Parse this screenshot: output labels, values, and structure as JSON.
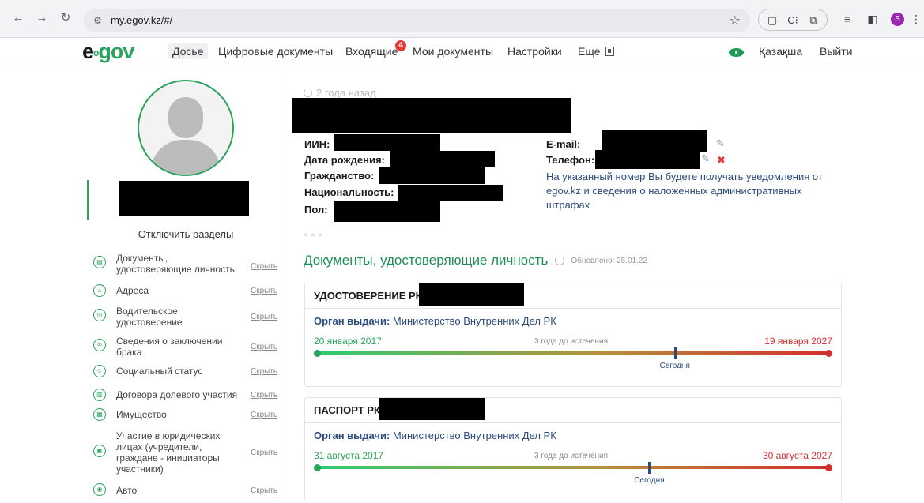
{
  "browser": {
    "url": "my.egov.kz/#/",
    "profile_initial": "S"
  },
  "header": {
    "logo_e": "e",
    "logo_o": "o",
    "logo_gov": "gov",
    "menu": [
      "Досье",
      "Цифровые документы",
      "Входящие",
      "Мои документы",
      "Настройки",
      "Еще"
    ],
    "inbox_count": "4",
    "language": "Қазақша",
    "logout": "Выйти"
  },
  "sidebar": {
    "toggle_sections": "Отключить разделы",
    "hide_label": "Скрыть",
    "items": [
      {
        "label": "Документы, удостоверяющие личность",
        "icon": "id-card-icon"
      },
      {
        "label": "Адреса",
        "icon": "home-icon"
      },
      {
        "label": "Водительское удостоверение",
        "icon": "steering-wheel-icon"
      },
      {
        "label": "Сведения о заключении брака",
        "icon": "rings-icon"
      },
      {
        "label": "Социальный статус",
        "icon": "people-icon"
      },
      {
        "label": "Договора долевого участия",
        "icon": "contract-icon"
      },
      {
        "label": "Имущество",
        "icon": "property-icon"
      },
      {
        "label": "Участие в юридических лицах (учредители, граждане - инициаторы, участники)",
        "icon": "legal-entity-icon"
      },
      {
        "label": "Авто",
        "icon": "car-icon"
      }
    ]
  },
  "profile": {
    "updated_ago": "2 года назад",
    "fields_left": [
      "ИИН:",
      "Дата рождения:",
      "Гражданство:",
      "Национальность:",
      "Пол:"
    ],
    "email_label": "E-mail:",
    "phone_label": "Телефон:",
    "phone_note": "На указанный номер Вы будете получать уведомления от egov.kz и сведения о наложенных административных штрафах"
  },
  "documents_section": {
    "title": "Документы, удостоверяющие личность",
    "updated": "Обновлено: 25.01.22",
    "cards": [
      {
        "title": "УДОСТОВЕРЕНИЕ РК",
        "issuer_label": "Орган выдачи:",
        "issuer": "Министерство Внутренних Дел РК",
        "issue_date": "20 января 2017",
        "expiry_date": "19 января 2027",
        "time_left": "3 года до истечения",
        "today_label": "Сегодня",
        "elapsed_fraction": 0.7
      },
      {
        "title": "ПАСПОРТ РК",
        "issuer_label": "Орган выдачи:",
        "issuer": "Министерство Внутренних Дел РК",
        "issue_date": "31 августа 2017",
        "expiry_date": "30 августа 2027",
        "time_left": "3 года до истечения",
        "today_label": "Сегодня",
        "elapsed_fraction": 0.65
      }
    ]
  },
  "colors": {
    "brand_green": "#2aa35c",
    "expiry_red": "#d32f2f",
    "text_blue": "#2b4c7e"
  }
}
